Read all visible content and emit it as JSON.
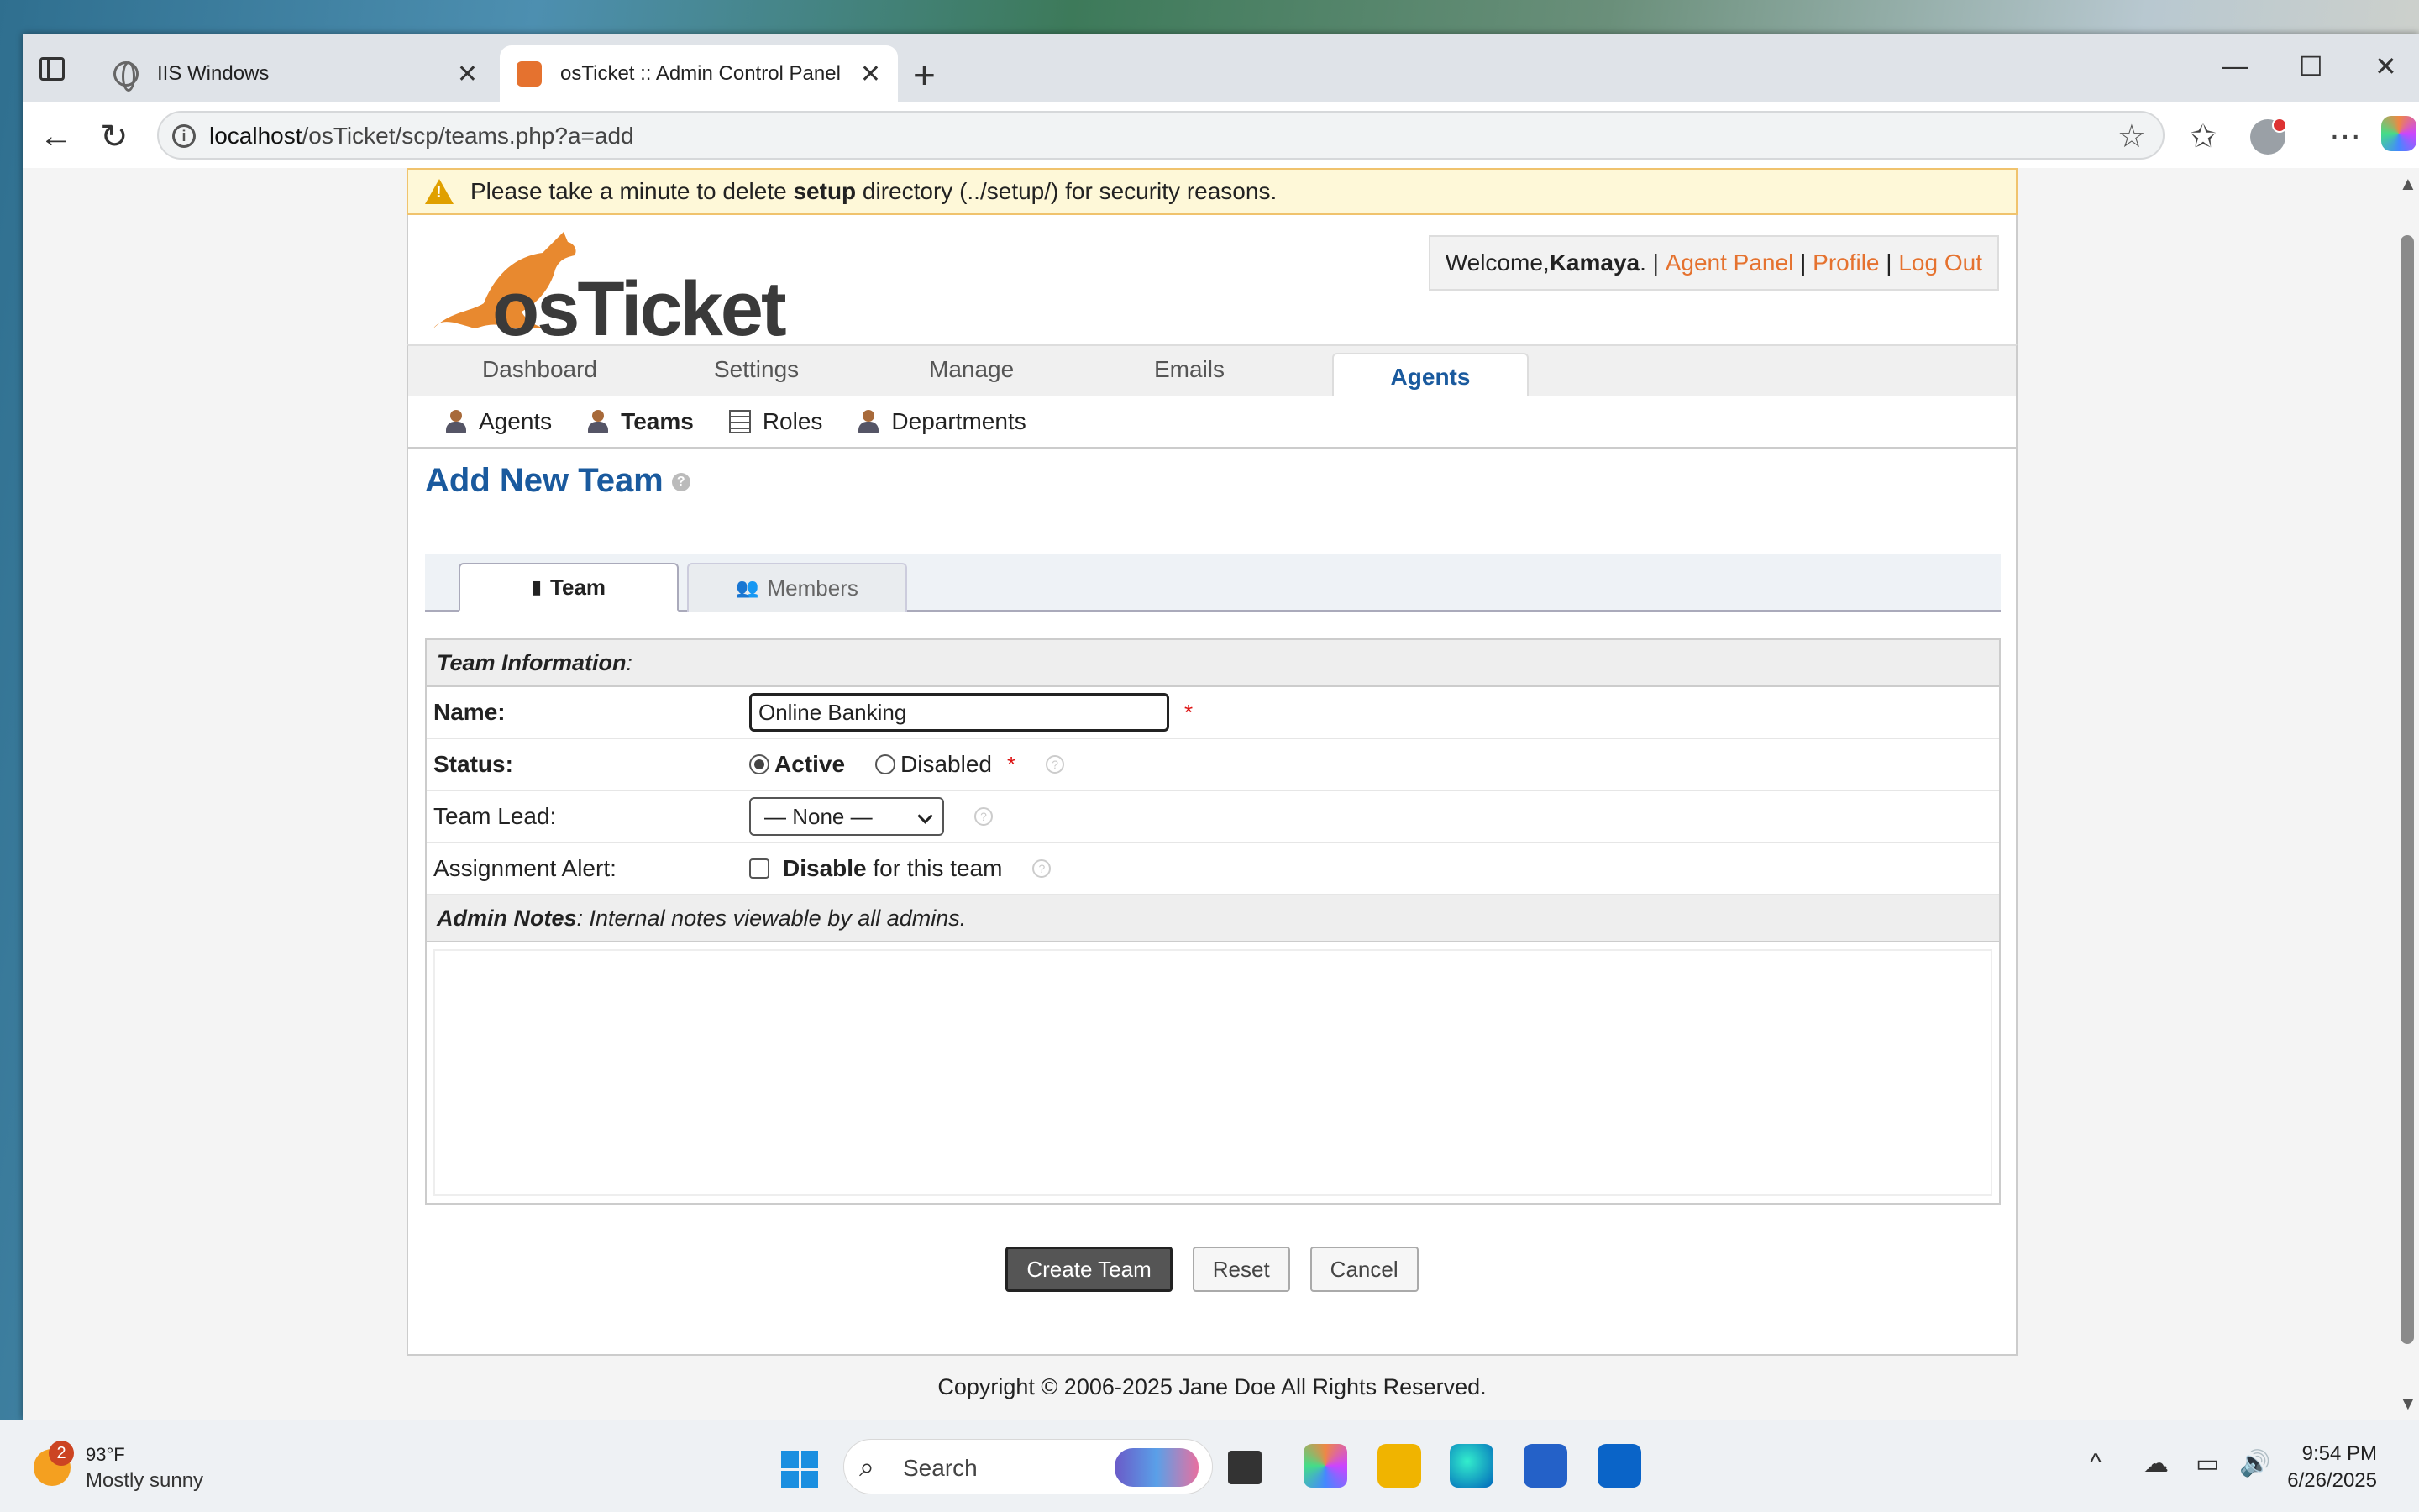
{
  "browser": {
    "tabs": [
      {
        "label": "IIS Windows",
        "close": "✕"
      },
      {
        "label": "osTicket :: Admin Control Panel",
        "close": "✕"
      }
    ],
    "new_tab": "+",
    "url_host": "localhost",
    "url_path": "/osTicket/scp/teams.php?a=add"
  },
  "warning": {
    "prefix": "Please take a minute to delete ",
    "bold": "setup",
    "suffix": " directory (../setup/) for security reasons."
  },
  "header": {
    "logo_text": "osTicket",
    "welcome_prefix": "Welcome, ",
    "user": "Kamaya",
    "links": [
      "Agent Panel",
      "Profile",
      "Log Out"
    ]
  },
  "nav": {
    "tabs": [
      "Dashboard",
      "Settings",
      "Manage",
      "Emails",
      "Agents"
    ],
    "active": "Agents"
  },
  "subnav": [
    "Agents",
    "Teams",
    "Roles",
    "Departments"
  ],
  "page": {
    "title": "Add New Team",
    "tabs": [
      "Team",
      "Members"
    ]
  },
  "form": {
    "section_title": "Team Information",
    "name_label": "Name:",
    "name_value": "Online Banking",
    "required": "*",
    "status_label": "Status:",
    "status_active": "Active",
    "status_disabled": "Disabled",
    "lead_label": "Team Lead:",
    "lead_value": "— None —",
    "alert_label": "Assignment Alert:",
    "alert_bold": "Disable",
    "alert_rest": " for this team",
    "notes_title": "Admin Notes",
    "notes_desc": ": Internal notes viewable by all admins."
  },
  "buttons": {
    "create": "Create Team",
    "reset": "Reset",
    "cancel": "Cancel"
  },
  "footer": "Copyright © 2006-2025 Jane Doe All Rights Reserved.",
  "taskbar": {
    "weather_badge": "2",
    "weather_temp": "93°F",
    "weather_desc": "Mostly sunny",
    "search_label": "Search",
    "time": "9:54 PM",
    "date": "6/26/2025"
  },
  "colors": {
    "accent": "#1a5a9e",
    "link": "#e5722f",
    "warning_bg": "#fef8d8"
  }
}
